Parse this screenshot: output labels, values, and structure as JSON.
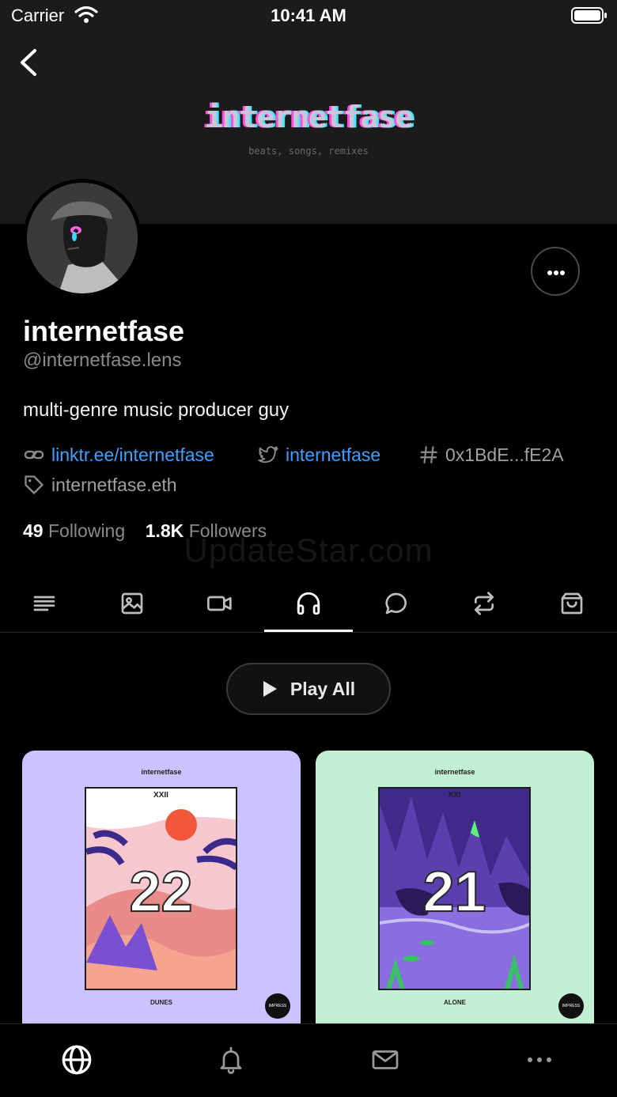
{
  "status_bar": {
    "carrier": "Carrier",
    "time": "10:41 AM"
  },
  "banner": {
    "title": "internetfase",
    "subtitle": "beats, songs, remixes"
  },
  "profile": {
    "name": "internetfase",
    "handle": "@internetfase.lens",
    "bio": "multi-genre music producer guy",
    "links": {
      "website": "linktr.ee/internetfase",
      "twitter": "internetfase",
      "address": "0x1BdE...fE2A",
      "ens": "internetfase.eth"
    },
    "stats": {
      "following_count": "49",
      "following_label": "Following",
      "followers_count": "1.8K",
      "followers_label": "Followers"
    }
  },
  "watermark": "UpdateStar.com",
  "tabs": [
    {
      "icon": "text-lines-icon",
      "active": false
    },
    {
      "icon": "image-icon",
      "active": false
    },
    {
      "icon": "video-icon",
      "active": false
    },
    {
      "icon": "headphones-icon",
      "active": true
    },
    {
      "icon": "comment-icon",
      "active": false
    },
    {
      "icon": "repost-icon",
      "active": false
    },
    {
      "icon": "shopping-bag-icon",
      "active": false
    }
  ],
  "play_all_label": "Play All",
  "albums": [
    {
      "artist": "internetfase",
      "roman": "XXII",
      "number": "22",
      "track": "DUNES",
      "badge": "IMPRESS YOURSELF",
      "bg": "#cbc3ff"
    },
    {
      "artist": "internetfase",
      "roman": "XXI",
      "number": "21",
      "track": "ALONE",
      "badge": "IMPRESS YOURSELF",
      "bg": "#c3f0d4"
    }
  ],
  "bottom_nav": [
    {
      "icon": "globe-icon"
    },
    {
      "icon": "bell-icon"
    },
    {
      "icon": "mail-icon"
    },
    {
      "icon": "more-horizontal-icon"
    }
  ],
  "colors": {
    "link": "#3ba0ff",
    "muted": "#8a8a8a",
    "background": "#000000"
  }
}
